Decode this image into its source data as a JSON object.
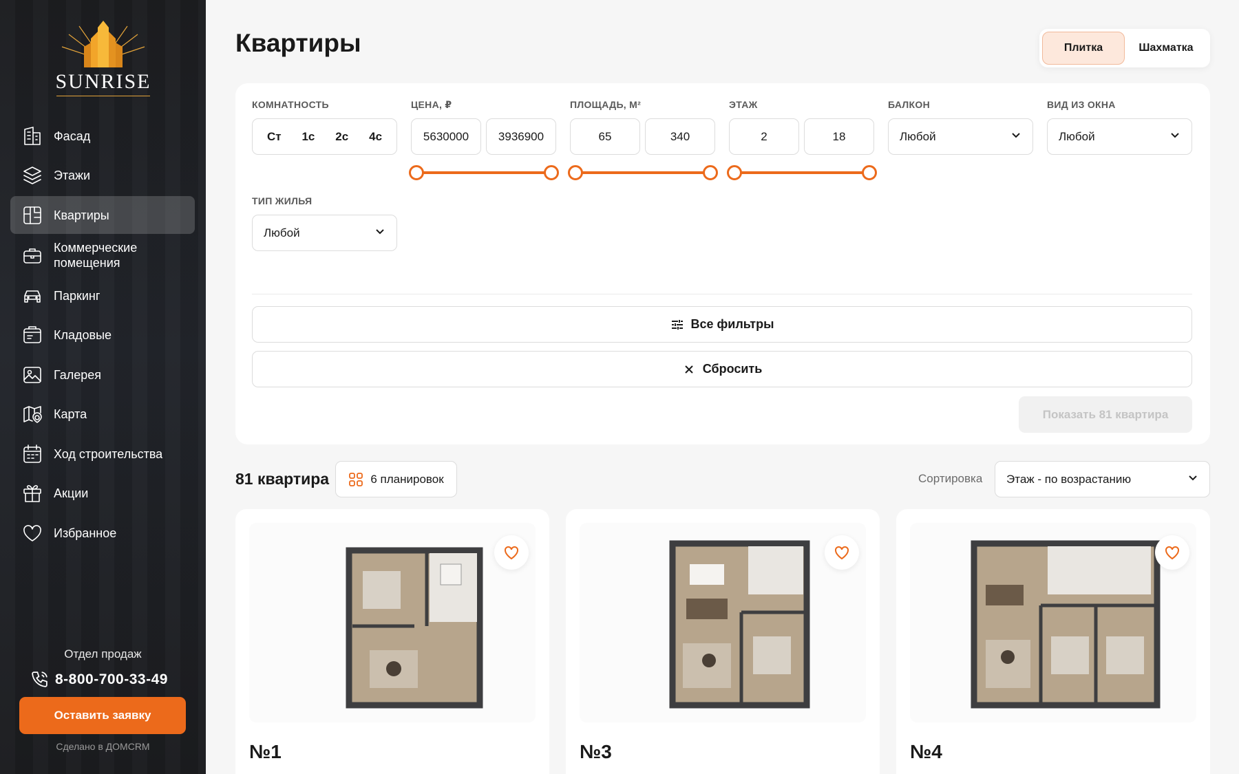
{
  "brand": {
    "name": "SUNRISE"
  },
  "sidebar": {
    "items": [
      {
        "label": "Фасад",
        "icon": "facade-icon"
      },
      {
        "label": "Этажи",
        "icon": "layers-icon"
      },
      {
        "label": "Квартиры",
        "icon": "apartment-icon",
        "active": true
      },
      {
        "label": "Коммерческие помещения",
        "icon": "briefcase-icon"
      },
      {
        "label": "Паркинг",
        "icon": "car-icon"
      },
      {
        "label": "Кладовые",
        "icon": "storage-icon"
      },
      {
        "label": "Галерея",
        "icon": "gallery-icon"
      },
      {
        "label": "Карта",
        "icon": "map-icon"
      },
      {
        "label": "Ход строительства",
        "icon": "calendar-icon"
      },
      {
        "label": "Акции",
        "icon": "gift-icon"
      },
      {
        "label": "Избранное",
        "icon": "heart-icon"
      }
    ],
    "sales_title": "Отдел продаж",
    "phone": "8-800-700-33-49",
    "cta_label": "Оставить заявку",
    "made_by": "Сделано в ДОМCRM"
  },
  "header": {
    "title": "Квартиры",
    "view_tiles": "Плитка",
    "view_chess": "Шахматка"
  },
  "filters": {
    "rooms": {
      "label": "КОМНАТНОСТЬ",
      "options": [
        "Ст",
        "1с",
        "2с",
        "4с"
      ]
    },
    "price": {
      "label": "ЦЕНА, ₽",
      "min": "5630000",
      "max": "3936900"
    },
    "area": {
      "label": "ПЛОЩАДЬ, М²",
      "min": "65",
      "max": "340"
    },
    "floor": {
      "label": "ЭТАЖ",
      "min": "2",
      "max": "18"
    },
    "balcony": {
      "label": "БАЛКОН",
      "value": "Любой"
    },
    "view": {
      "label": "ВИД ИЗ ОКНА",
      "value": "Любой"
    },
    "housing_type": {
      "label": "ТИП ЖИЛЬЯ",
      "value": "Любой"
    },
    "all_filters_label": "Все фильтры",
    "reset_label": "Сбросить",
    "show_label": "Показать 81 квартира"
  },
  "results": {
    "count_label": "81 квартира",
    "layouts_label": "6 планировок",
    "sort_label": "Сортировка",
    "sort_value": "Этаж - по возрастанию"
  },
  "cards": [
    {
      "title": "№1"
    },
    {
      "title": "№3"
    },
    {
      "title": "№4"
    }
  ],
  "colors": {
    "accent": "#ec6a1b",
    "sidebar_bg": "#1f2125",
    "page_bg": "#f6f6f6"
  }
}
